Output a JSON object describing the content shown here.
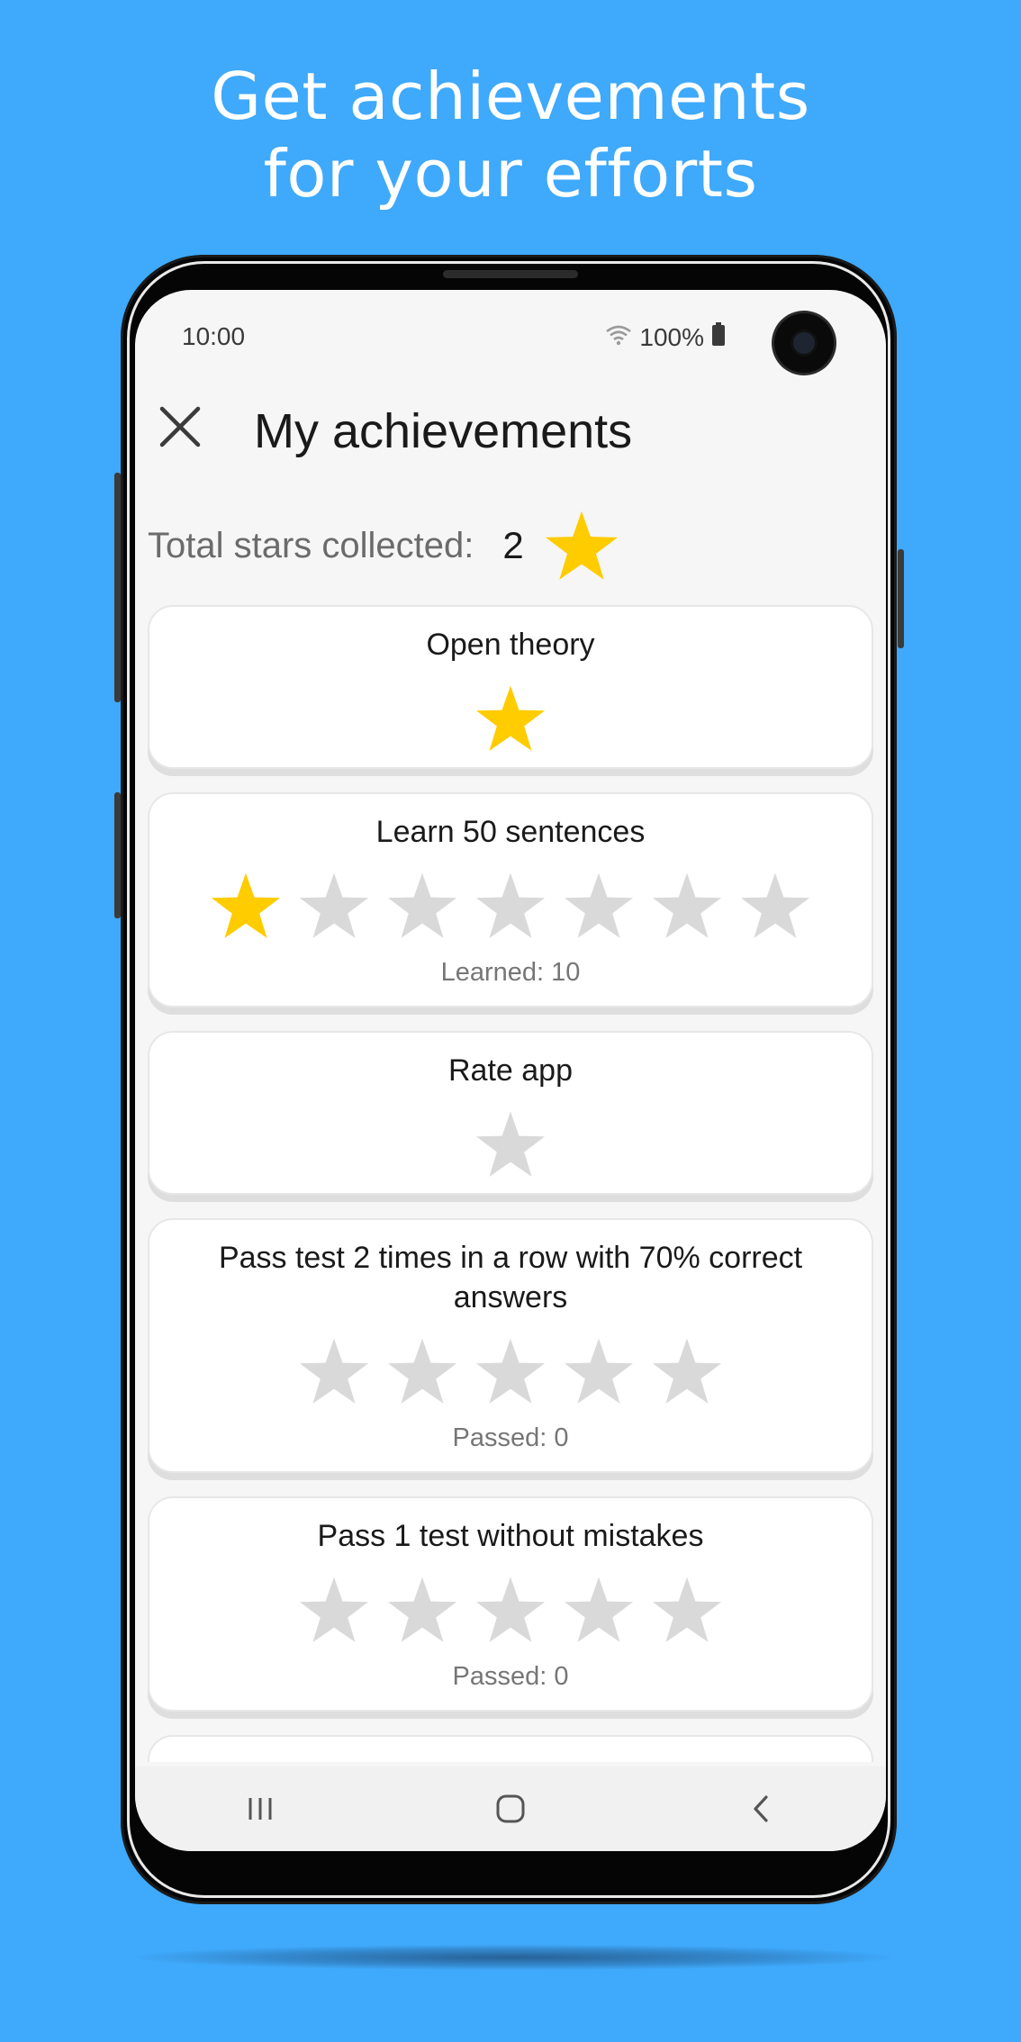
{
  "promo": {
    "headline_line1": "Get achievements",
    "headline_line2": "for your efforts"
  },
  "status_bar": {
    "time": "10:00",
    "battery": "100%",
    "icons": [
      "wifi-icon",
      "battery-icon"
    ]
  },
  "app_bar": {
    "title": "My achievements",
    "close_icon": "close-icon"
  },
  "summary": {
    "label": "Total stars collected:",
    "count": "2"
  },
  "colors": {
    "background": "#3fa9fb",
    "star_filled": "#ffcc00",
    "star_empty": "#d9d9d9"
  },
  "achievements": [
    {
      "title": "Open theory",
      "stars_total": 1,
      "stars_filled": 1,
      "progress": ""
    },
    {
      "title": "Learn 50 sentences",
      "stars_total": 7,
      "stars_filled": 1,
      "progress": "Learned: 10"
    },
    {
      "title": "Rate app",
      "stars_total": 1,
      "stars_filled": 0,
      "progress": ""
    },
    {
      "title": "Pass test 2 times in a row with 70% correct answers",
      "stars_total": 5,
      "stars_filled": 0,
      "progress": "Passed: 0"
    },
    {
      "title": "Pass 1 test without mistakes",
      "stars_total": 5,
      "stars_filled": 0,
      "progress": "Passed: 0"
    }
  ],
  "nav_bar": {
    "buttons": [
      "recent-apps-icon",
      "home-icon",
      "back-icon"
    ]
  }
}
